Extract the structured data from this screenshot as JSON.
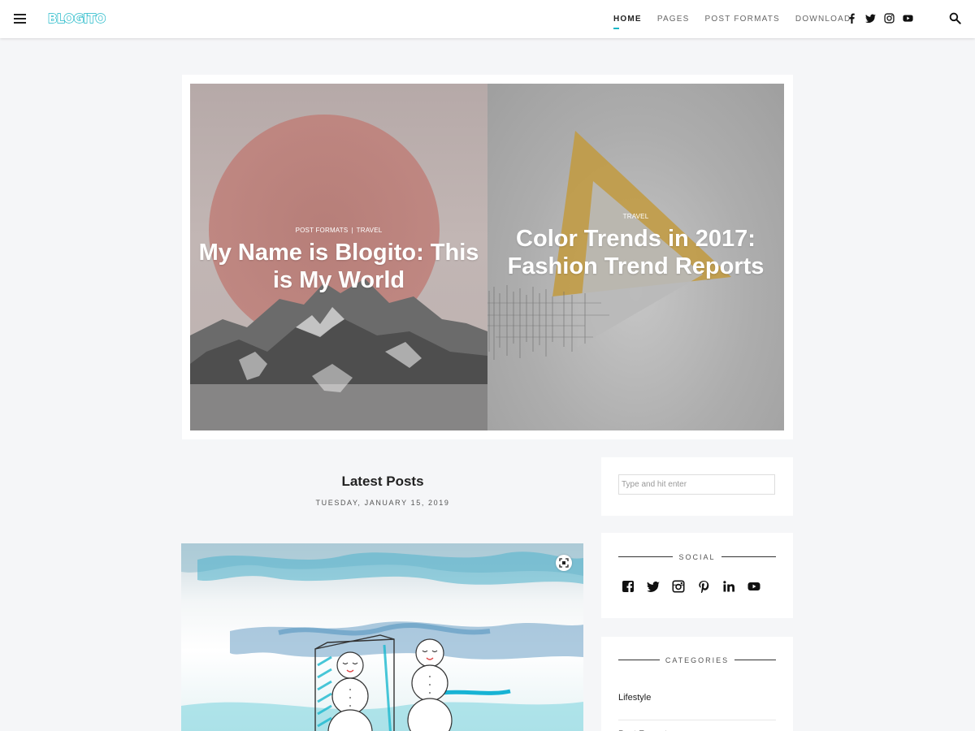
{
  "header": {
    "logo": "BLOGITO",
    "nav": [
      {
        "label": "HOME",
        "active": true
      },
      {
        "label": "PAGES",
        "active": false
      },
      {
        "label": "POST FORMATS",
        "active": false
      },
      {
        "label": "DOWNLOAD",
        "active": false
      }
    ],
    "social_icons": [
      "facebook-icon",
      "twitter-icon",
      "instagram-icon",
      "youtube-icon"
    ],
    "accent_color": "#19b6c6"
  },
  "slider": [
    {
      "categories": [
        "POST FORMATS",
        "TRAVEL"
      ],
      "category_separator": "|",
      "title": "My Name is Blogito: This is My World"
    },
    {
      "categories": [
        "TRAVEL"
      ],
      "title": "Color Trends in 2017: Fashion Trend Reports"
    }
  ],
  "latest": {
    "title": "Latest Posts",
    "date": "TUESDAY, JANUARY 15, 2019"
  },
  "sidebar": {
    "search": {
      "placeholder": "Type and hit enter",
      "value": ""
    },
    "social": {
      "title": "SOCIAL",
      "icons": [
        "facebook-icon",
        "twitter-icon",
        "instagram-icon",
        "pinterest-icon",
        "linkedin-icon",
        "youtube-icon"
      ]
    },
    "categories": {
      "title": "CATEGORIES",
      "items": [
        "Lifestyle",
        "Post Formats"
      ]
    }
  }
}
